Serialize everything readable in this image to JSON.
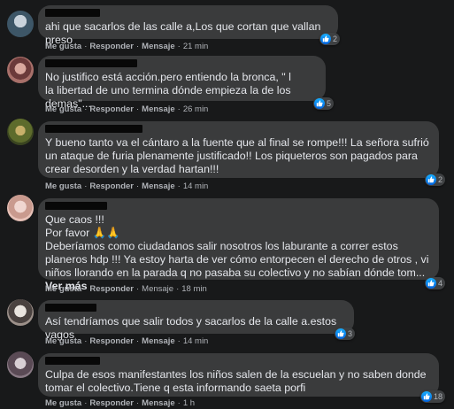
{
  "labels": {
    "like": "Me gusta",
    "reply": "Responder",
    "message": "Mensaje",
    "see_more": "Ver más"
  },
  "colors": {
    "background": "#18191a",
    "bubble": "#3a3b3c",
    "text": "#e4e6eb",
    "meta": "#b0b3b8",
    "like_blue": "#1877f2"
  },
  "comments": [
    {
      "text": "ahi que sacarlos de las calle a,Los que cortan que vallan preso",
      "time": "21 min",
      "reactions": "2"
    },
    {
      "text": "No justifico está acción.pero entiendo la bronca, \" l\nla libertad de uno termina dónde empieza la de los demas\"...",
      "time": "26 min",
      "reactions": "5"
    },
    {
      "text": "Y bueno tanto va el cántaro a la fuente que al final se rompe!!! La señora sufrió un ataque de furia plenamente justificado!! Los piqueteros son pagados para crear desorden y la verdad hartan!!!",
      "time": "14 min",
      "reactions": "2"
    },
    {
      "text": "Que caos !!!\nPor favor 🙏🙏\nDeberíamos como ciudadanos salir nosotros los laburante a correr estos planeros hdp !!! Ya estoy harta de ver cómo entorpecen el derecho de otros , vi niños llorando en la parada q no pasaba su colectivo y no sabían dónde tom...",
      "time": "18 min",
      "reactions": "4"
    },
    {
      "text": "Así tendríamos que salir todos y sacarlos de la calle a.estos vagos",
      "time": "14 min",
      "reactions": "3"
    },
    {
      "text": "Culpa de esos manifestantes los niños salen de la escuelan y no saben donde tomar el colectivo.Tiene q esta informando saeta porfi",
      "time": "1 h",
      "reactions": "18"
    }
  ]
}
